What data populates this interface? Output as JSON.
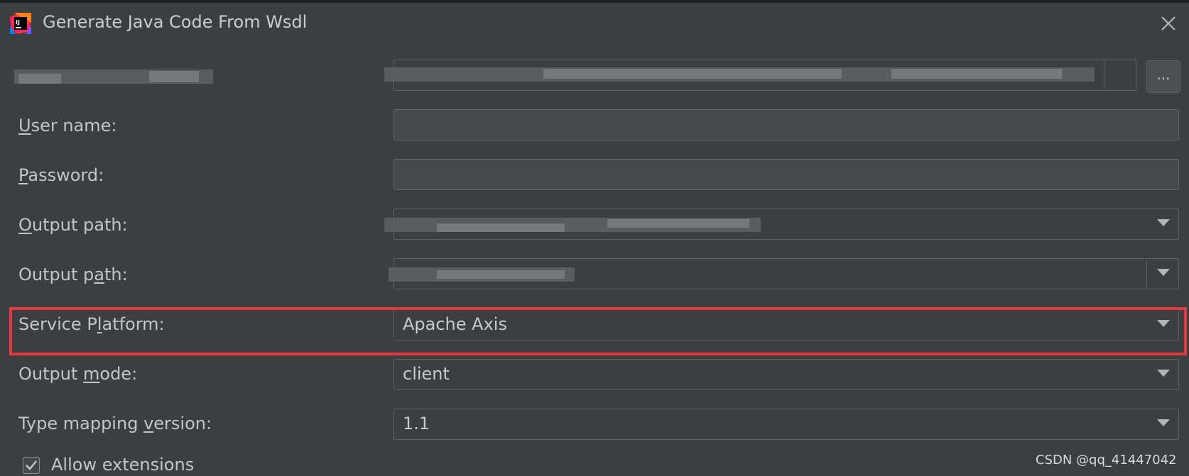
{
  "window": {
    "title": "Generate Java Code From Wsdl"
  },
  "form": {
    "user_name_label": "ser name:",
    "user_name_mnemonic": "U",
    "user_name_value": "",
    "password_label": "assword:",
    "password_mnemonic": "P",
    "password_value": "",
    "output_path_1_label": "utput path:",
    "output_path_1_mnemonic": "O",
    "output_path_2_label_a": "Output p",
    "output_path_2_mnemonic": "a",
    "output_path_2_label_b": "th:",
    "service_platform_label_a": "Service P",
    "service_platform_mnemonic": "l",
    "service_platform_label_b": "atform:",
    "service_platform_value": "Apache Axis",
    "output_mode_label_a": "Output ",
    "output_mode_mnemonic": "m",
    "output_mode_label_b": "ode:",
    "output_mode_value": "client",
    "type_mapping_label_a": "Type mapping ",
    "type_mapping_mnemonic": "v",
    "type_mapping_label_b": "ersion:",
    "type_mapping_value": "1.1",
    "browse_label": "...",
    "allow_extensions_label": "Allow extensions",
    "allow_extensions_checked": true
  },
  "watermark": "CSDN @qq_41447042",
  "icons": {
    "app": "intellij-idea-icon",
    "close": "close-icon",
    "dropdown": "chevron-down-icon",
    "check": "check-icon"
  },
  "colors": {
    "background": "#3c3f41",
    "highlight": "#e5393f"
  }
}
